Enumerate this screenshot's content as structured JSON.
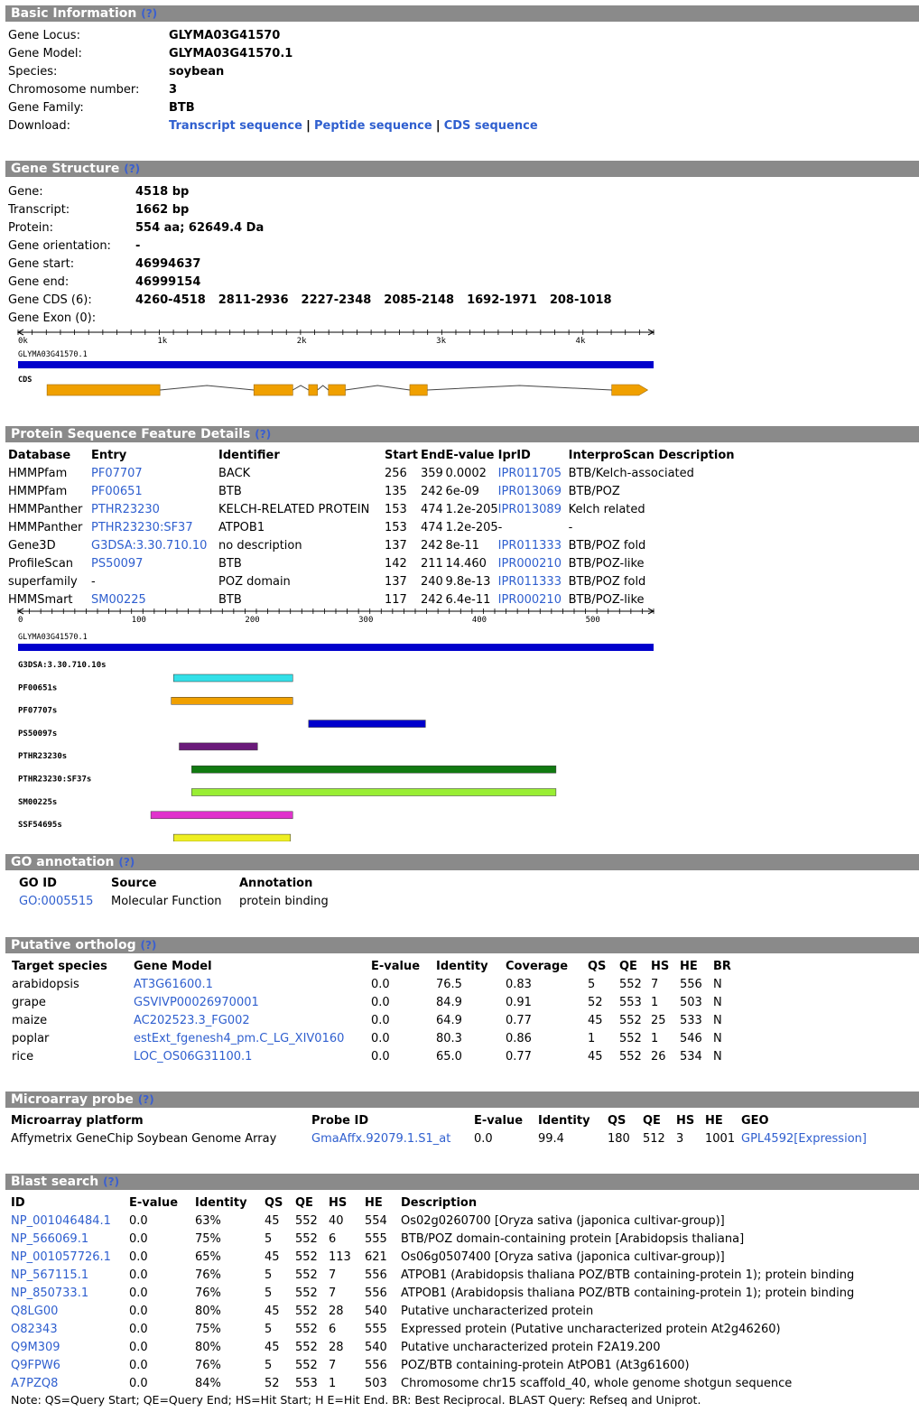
{
  "basic": {
    "title": "Basic Information",
    "help": "(?)",
    "rows": [
      {
        "label": "Gene Locus:",
        "value": "GLYMA03G41570"
      },
      {
        "label": "Gene Model:",
        "value": "GLYMA03G41570.1"
      },
      {
        "label": "Species:",
        "value": "soybean"
      },
      {
        "label": "Chromosome number:",
        "value": "3"
      },
      {
        "label": "Gene Family:",
        "value": "BTB"
      }
    ],
    "download_label": "Download:",
    "download_links": [
      "Transcript sequence",
      "Peptide sequence",
      "CDS sequence"
    ],
    "sep": "|"
  },
  "structure": {
    "title": "Gene Structure",
    "help": "(?)",
    "rows": [
      {
        "label": "Gene:",
        "value": "4518 bp"
      },
      {
        "label": "Transcript:",
        "value": "1662 bp"
      },
      {
        "label": "Protein:",
        "value": "554 aa; 62649.4 Da"
      },
      {
        "label": "Gene orientation:",
        "value": "-"
      },
      {
        "label": "Gene start:",
        "value": "46994637"
      },
      {
        "label": "Gene end:",
        "value": "46999154"
      }
    ],
    "cds_label": "Gene CDS (6):",
    "cds": [
      "4260-4518",
      "2811-2936",
      "2227-2348",
      "2085-2148",
      "1692-1971",
      "208-1018"
    ],
    "exon_label": "Gene Exon (0):",
    "ruler_labels": [
      "0k",
      "1k",
      "2k",
      "3k",
      "4k"
    ],
    "track_label": "GLYMA03G41570.1",
    "cds_track_label": "CDS",
    "gene_length": 4518,
    "cds_segments": [
      [
        208,
        1018
      ],
      [
        1692,
        1971
      ],
      [
        2085,
        2148
      ],
      [
        2227,
        2348
      ],
      [
        2811,
        2936
      ],
      [
        4260,
        4518
      ]
    ],
    "track_color": "#0000cc",
    "cds_color": "#f0a000"
  },
  "protein": {
    "title": "Protein Sequence Feature Details",
    "help": "(?)",
    "headers": [
      "Database",
      "Entry",
      "Identifier",
      "Start",
      "End",
      "E-value",
      "IprID",
      "InterproScan Description"
    ],
    "rows": [
      [
        "HMMPfam",
        "PF07707",
        "BACK",
        "256",
        "359",
        "0.0002",
        "IPR011705",
        "BTB/Kelch-associated"
      ],
      [
        "HMMPfam",
        "PF00651",
        "BTB",
        "135",
        "242",
        "6e-09",
        "IPR013069",
        "BTB/POZ"
      ],
      [
        "HMMPanther",
        "PTHR23230",
        "KELCH-RELATED PROTEIN",
        "153",
        "474",
        "1.2e-205",
        "IPR013089",
        "Kelch related"
      ],
      [
        "HMMPanther",
        "PTHR23230:SF37",
        "ATPOB1",
        "153",
        "474",
        "1.2e-205",
        "-",
        "-"
      ],
      [
        "Gene3D",
        "G3DSA:3.30.710.10",
        "no description",
        "137",
        "242",
        "8e-11",
        "IPR011333",
        "BTB/POZ fold"
      ],
      [
        "ProfileScan",
        "PS50097",
        "BTB",
        "142",
        "211",
        "14.460",
        "IPR000210",
        "BTB/POZ-like"
      ],
      [
        "superfamily",
        "-",
        "POZ domain",
        "137",
        "240",
        "9.8e-13",
        "IPR011333",
        "BTB/POZ fold"
      ],
      [
        "HMMSmart",
        "SM00225",
        "BTB",
        "117",
        "242",
        "6.4e-11",
        "IPR000210",
        "BTB/POZ-like"
      ]
    ],
    "ruler_labels": [
      "0",
      "100",
      "200",
      "300",
      "400",
      "500"
    ],
    "protein_length": 554,
    "track_label": "GLYMA03G41570.1",
    "domains": [
      {
        "label": "G3DSA:3.30.710.10s",
        "start": 137,
        "end": 242,
        "color": "#33e0e8"
      },
      {
        "label": "PF00651s",
        "start": 135,
        "end": 242,
        "color": "#f0a000"
      },
      {
        "label": "PF07707s",
        "start": 256,
        "end": 359,
        "color": "#0000cc"
      },
      {
        "label": "PS50097s",
        "start": 142,
        "end": 211,
        "color": "#6a1a7a"
      },
      {
        "label": "PTHR23230s",
        "start": 153,
        "end": 474,
        "color": "#117a11"
      },
      {
        "label": "PTHR23230:SF37s",
        "start": 153,
        "end": 474,
        "color": "#99ee33"
      },
      {
        "label": "SM00225s",
        "start": 117,
        "end": 242,
        "color": "#e033cc"
      },
      {
        "label": "SSF54695s",
        "start": 137,
        "end": 240,
        "color": "#eeee22"
      }
    ]
  },
  "go": {
    "title": "GO annotation",
    "help": "(?)",
    "headers": [
      "GO ID",
      "Source",
      "Annotation"
    ],
    "rows": [
      [
        "GO:0005515",
        "Molecular Function",
        "protein binding"
      ]
    ]
  },
  "ortholog": {
    "title": "Putative ortholog",
    "help": "(?)",
    "headers": [
      "Target species",
      "Gene Model",
      "E-value",
      "Identity",
      "Coverage",
      "QS",
      "QE",
      "HS",
      "HE",
      "BR"
    ],
    "rows": [
      [
        "arabidopsis",
        "AT3G61600.1",
        "0.0",
        "76.5",
        "0.83",
        "5",
        "552",
        "7",
        "556",
        "N"
      ],
      [
        "grape",
        "GSVIVP00026970001",
        "0.0",
        "84.9",
        "0.91",
        "52",
        "553",
        "1",
        "503",
        "N"
      ],
      [
        "maize",
        "AC202523.3_FG002",
        "0.0",
        "64.9",
        "0.77",
        "45",
        "552",
        "25",
        "533",
        "N"
      ],
      [
        "poplar",
        "estExt_fgenesh4_pm.C_LG_XIV0160",
        "0.0",
        "80.3",
        "0.86",
        "1",
        "552",
        "1",
        "546",
        "N"
      ],
      [
        "rice",
        "LOC_OS06G31100.1",
        "0.0",
        "65.0",
        "0.77",
        "45",
        "552",
        "26",
        "534",
        "N"
      ]
    ]
  },
  "microarray": {
    "title": "Microarray probe",
    "help": "(?)",
    "headers": [
      "Microarray platform",
      "Probe ID",
      "E-value",
      "Identity",
      "QS",
      "QE",
      "HS",
      "HE",
      "GEO"
    ],
    "rows": [
      [
        "Affymetrix GeneChip Soybean Genome Array",
        "GmaAffx.92079.1.S1_at",
        "0.0",
        "99.4",
        "180",
        "512",
        "3",
        "1001",
        "GPL4592",
        "[Expression]"
      ]
    ]
  },
  "blast": {
    "title": "Blast search",
    "help": "(?)",
    "headers": [
      "ID",
      "E-value",
      "Identity",
      "QS",
      "QE",
      "HS",
      "HE",
      "Description"
    ],
    "rows": [
      [
        "NP_001046484.1",
        "0.0",
        "63%",
        "45",
        "552",
        "40",
        "554",
        "Os02g0260700 [Oryza sativa (japonica cultivar-group)]"
      ],
      [
        "NP_566069.1",
        "0.0",
        "75%",
        "5",
        "552",
        "6",
        "555",
        "BTB/POZ domain-containing protein [Arabidopsis thaliana]"
      ],
      [
        "NP_001057726.1",
        "0.0",
        "65%",
        "45",
        "552",
        "113",
        "621",
        "Os06g0507400 [Oryza sativa (japonica cultivar-group)]"
      ],
      [
        "NP_567115.1",
        "0.0",
        "76%",
        "5",
        "552",
        "7",
        "556",
        "ATPOB1 (Arabidopsis thaliana POZ/BTB containing-protein 1); protein binding"
      ],
      [
        "NP_850733.1",
        "0.0",
        "76%",
        "5",
        "552",
        "7",
        "556",
        "ATPOB1 (Arabidopsis thaliana POZ/BTB containing-protein 1); protein binding"
      ],
      [
        "Q8LG00",
        "0.0",
        "80%",
        "45",
        "552",
        "28",
        "540",
        "Putative uncharacterized protein"
      ],
      [
        "O82343",
        "0.0",
        "75%",
        "5",
        "552",
        "6",
        "555",
        "Expressed protein (Putative uncharacterized protein At2g46260)"
      ],
      [
        "Q9M309",
        "0.0",
        "80%",
        "45",
        "552",
        "28",
        "540",
        "Putative uncharacterized protein F2A19.200"
      ],
      [
        "Q9FPW6",
        "0.0",
        "76%",
        "5",
        "552",
        "7",
        "556",
        "POZ/BTB containing-protein AtPOB1 (At3g61600)"
      ],
      [
        "A7PZQ8",
        "0.0",
        "84%",
        "52",
        "553",
        "1",
        "503",
        "Chromosome chr15 scaffold_40, whole genome shotgun sequence"
      ]
    ],
    "note": "Note: QS=Query Start;  QE=Query End;  HS=Hit Start;  H E=Hit End. BR: Best Reciprocal. BLAST Query: Refseq and Uniprot."
  }
}
